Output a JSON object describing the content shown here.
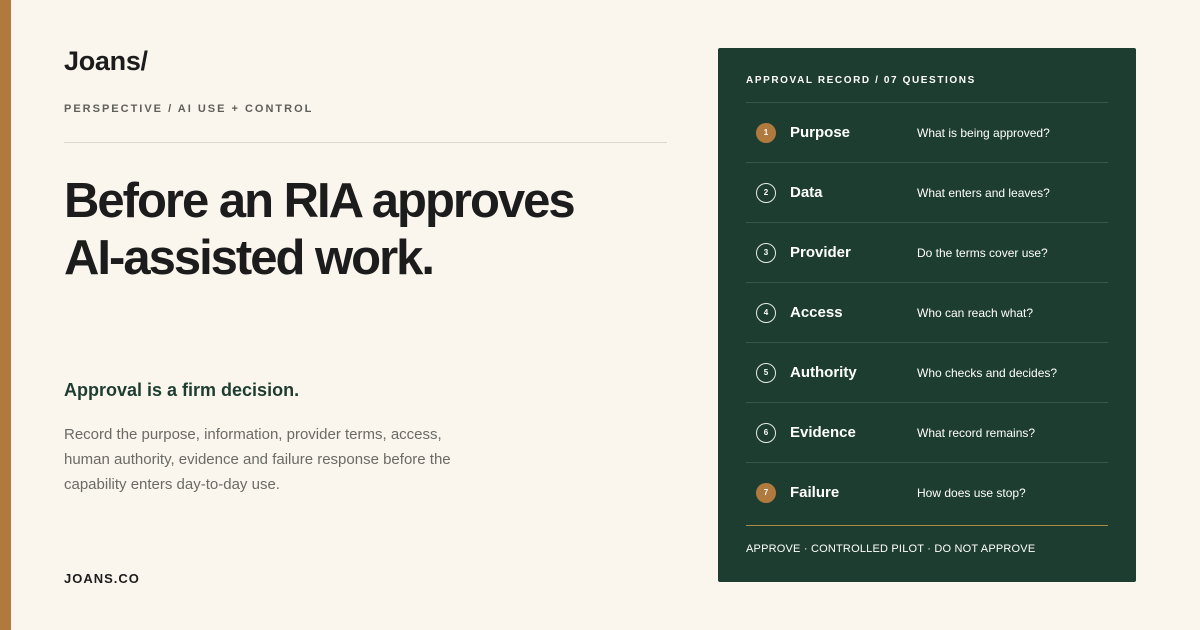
{
  "brand": "Joans/",
  "kicker": "PERSPECTIVE / AI USE + CONTROL",
  "headline": "Before an RIA approves AI-assisted work.",
  "subhead": "Approval is a firm decision.",
  "body": "Record the purpose, information, provider terms, access, human authority, evidence and failure response before the capability enters day-to-day use.",
  "footer": "JOANS.CO",
  "colors": {
    "background": "#faf5ed",
    "accent": "#b07a3e",
    "card": "#1e3d31"
  },
  "card": {
    "title": "APPROVAL RECORD / 07 QUESTIONS",
    "items": [
      {
        "num": "1",
        "label": "Purpose",
        "question": "What is being approved?",
        "highlight": true
      },
      {
        "num": "2",
        "label": "Data",
        "question": "What enters and leaves?",
        "highlight": false
      },
      {
        "num": "3",
        "label": "Provider",
        "question": "Do the terms cover use?",
        "highlight": false
      },
      {
        "num": "4",
        "label": "Access",
        "question": "Who can reach what?",
        "highlight": false
      },
      {
        "num": "5",
        "label": "Authority",
        "question": "Who checks and decides?",
        "highlight": false
      },
      {
        "num": "6",
        "label": "Evidence",
        "question": "What record remains?",
        "highlight": false
      },
      {
        "num": "7",
        "label": "Failure",
        "question": "How does use stop?",
        "highlight": true
      }
    ],
    "options": "APPROVE · CONTROLLED PILOT · DO NOT APPROVE"
  }
}
